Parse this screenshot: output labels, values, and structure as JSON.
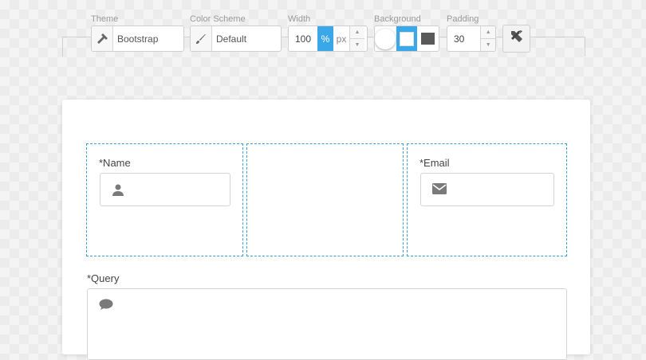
{
  "toolbar": {
    "theme": {
      "label": "Theme",
      "value": "Bootstrap",
      "icon": "hammer-icon"
    },
    "color_scheme": {
      "label": "Color Scheme",
      "value": "Default",
      "icon": "brush-icon"
    },
    "width": {
      "label": "Width",
      "value": "100",
      "unit_percent": "%",
      "unit_px": "px",
      "selected_unit": "%"
    },
    "background": {
      "label": "Background",
      "options": [
        "white-circle",
        "light",
        "dark"
      ],
      "selected": "light"
    },
    "padding": {
      "label": "Padding",
      "value": "30"
    },
    "tools_icon": "tools-icon"
  },
  "form": {
    "name": {
      "label": "*Name",
      "icon": "user-icon",
      "value": ""
    },
    "email": {
      "label": "*Email",
      "icon": "envelope-icon",
      "value": ""
    },
    "query": {
      "label": "*Query",
      "icon": "comment-icon",
      "value": ""
    }
  },
  "colors": {
    "accent": "#3aa8e8",
    "dashed_border": "#3aa0d8",
    "icon_gray": "#7a7a7a"
  }
}
